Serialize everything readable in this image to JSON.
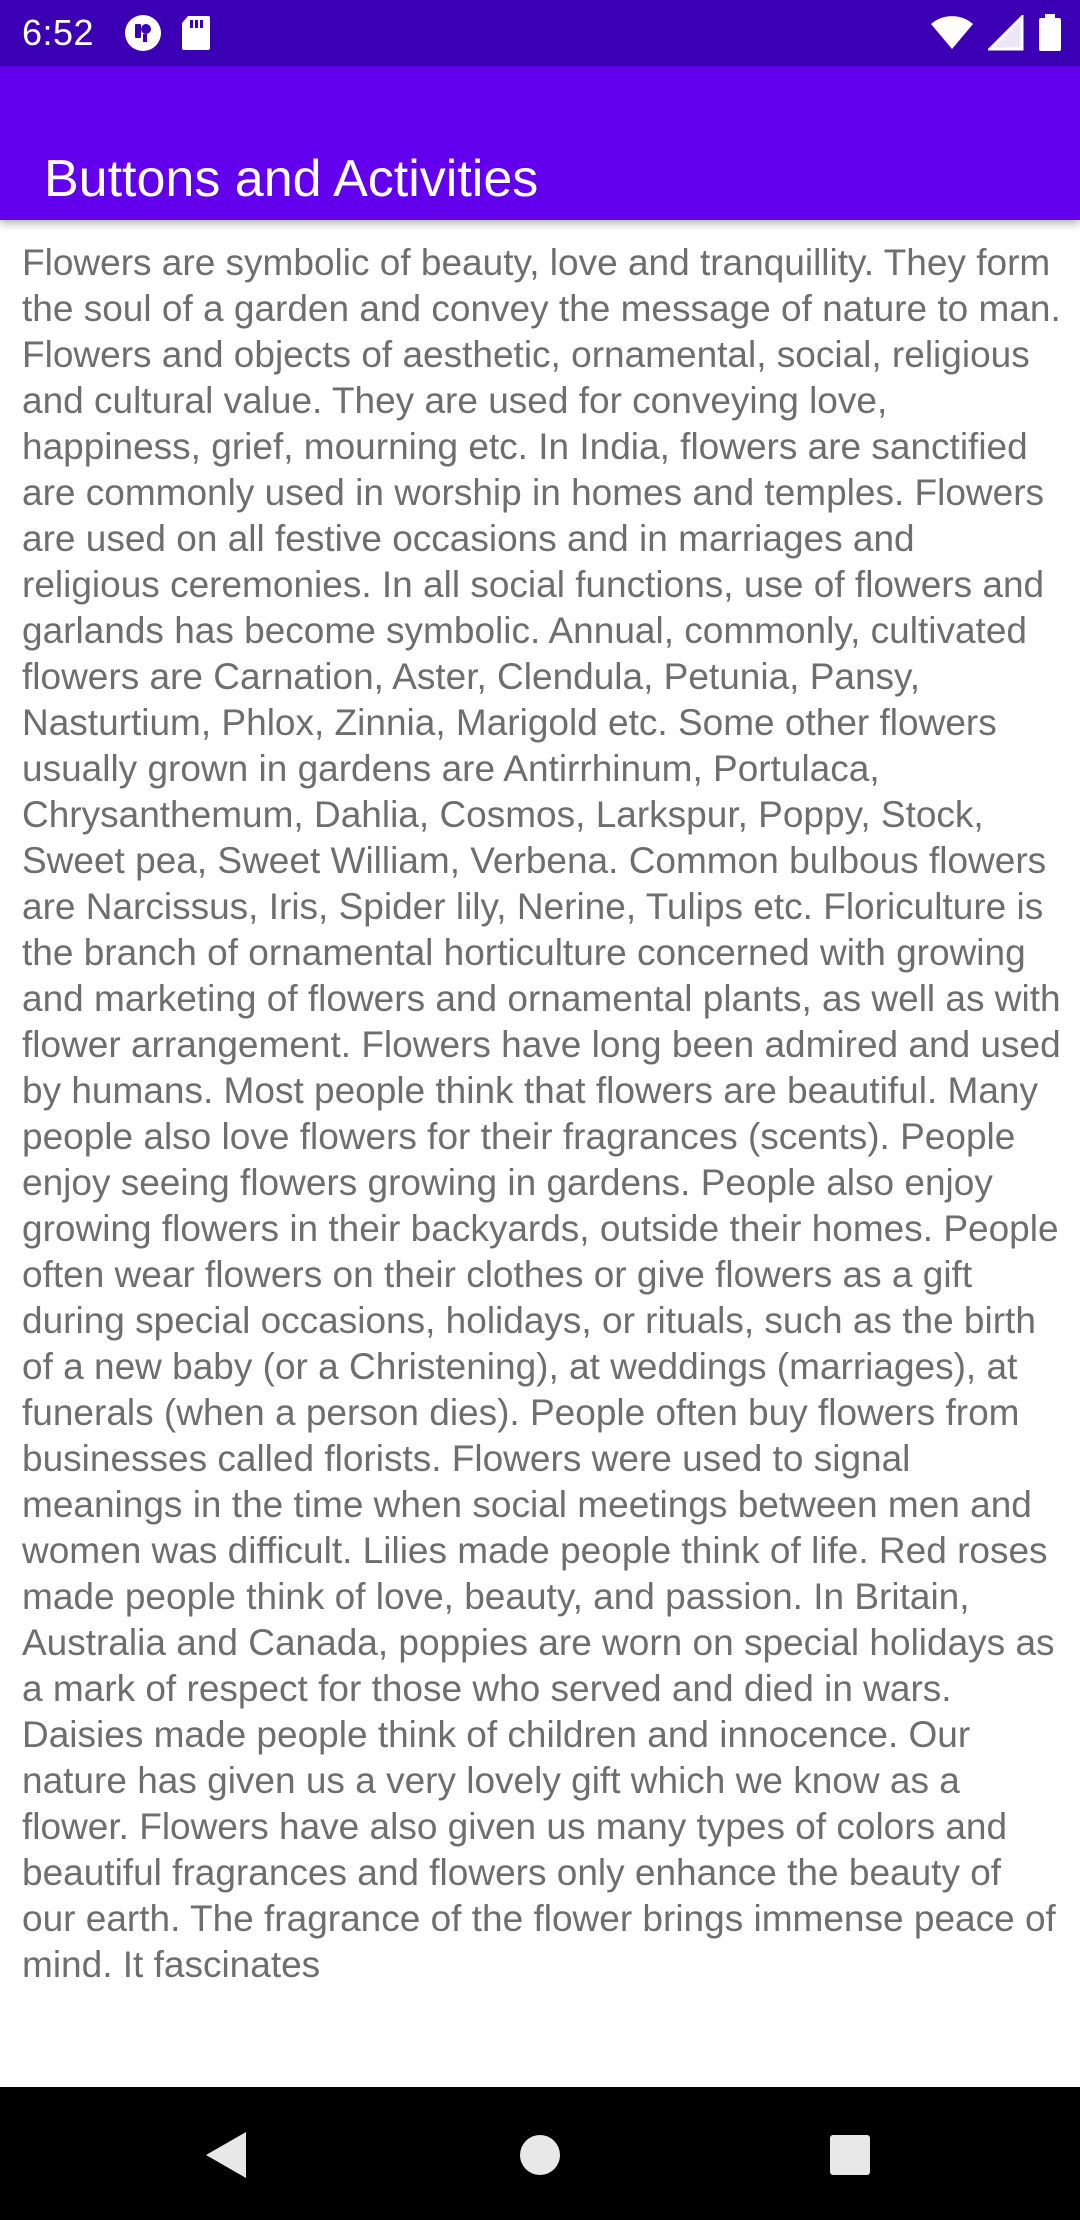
{
  "status_bar": {
    "time": "6:52",
    "left_icons": [
      "notification-app-icon",
      "sd-card-icon"
    ],
    "right_icons": [
      "wifi-icon",
      "cellular-signal-icon",
      "battery-icon"
    ]
  },
  "app_bar": {
    "title": "Buttons and Activities",
    "color": "#6200ee"
  },
  "content": {
    "text": "Flowers are symbolic of beauty, love and tranquillity. They form the soul of a garden and convey the message of nature to man. Flowers and objects of aesthetic, ornamental, social, religious and cultural value. They are used for conveying love, happiness, grief, mourning etc. In India, flowers are sanctified are commonly used in worship in homes and temples. Flowers are used on all festive occasions and in marriages and religious ceremonies. In all social functions, use of flowers and garlands has become symbolic. Annual, commonly, cultivated flowers are Carnation, Aster, Clendula, Petunia, Pansy, Nasturtium, Phlox, Zinnia, Marigold etc. Some other flowers usually grown in gardens are Antirrhinum, Portulaca, Chrysanthemum, Dahlia, Cosmos, Larkspur, Poppy, Stock, Sweet pea, Sweet William, Verbena. Common bulbous flowers are Narcissus, Iris, Spider lily, Nerine, Tulips etc. Floriculture is the branch of ornamental horticulture concerned with growing and marketing of flowers and ornamental plants, as well as with flower arrangement. Flowers have long been admired and used by humans. Most people think that flowers are beautiful. Many people also love flowers for their fragrances (scents). People enjoy seeing flowers growing in gardens. People also enjoy growing flowers in their backyards, outside their homes. People often wear flowers on their clothes or give flowers as a gift during special occasions, holidays, or rituals, such as the birth of a new baby (or a Christening), at weddings (marriages), at funerals (when a person dies). People often buy flowers from businesses called florists. Flowers were used to signal meanings in the time when social meetings between men and women was difficult. Lilies made people think of life. Red roses made people think of love, beauty, and passion. In Britain, Australia and Canada, poppies are worn on special holidays as a mark of respect for those who served and died in wars. Daisies made people think of children and innocence. Our nature has given us a very lovely gift which we know as a flower. Flowers have also given us many types of colors and beautiful fragrances and flowers only enhance the beauty of our earth. The fragrance of the flower brings immense peace of mind. It fascinates"
  },
  "nav_bar": {
    "buttons": [
      "back-icon",
      "home-icon",
      "recents-icon"
    ]
  }
}
